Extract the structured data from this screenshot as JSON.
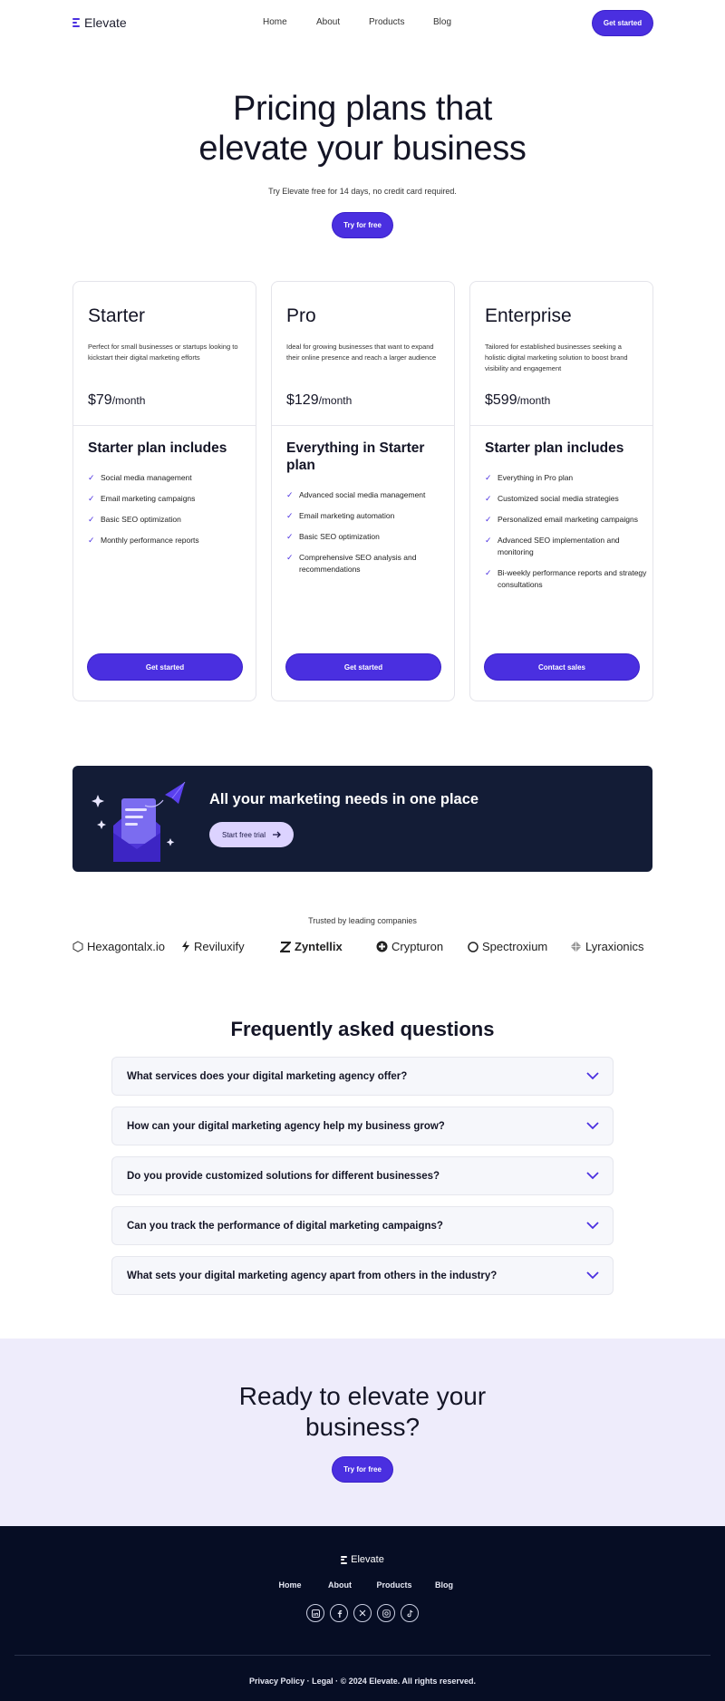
{
  "colors": {
    "accent": "#4a2fe0",
    "banner_bg": "#131c36",
    "cta_bg": "#eeecfb",
    "footer_bg": "#060d24"
  },
  "nav": {
    "brand": "Elevate",
    "links": [
      "Home",
      "About",
      "Products",
      "Blog"
    ],
    "cta": "Get started"
  },
  "hero": {
    "title_line1": "Pricing plans that",
    "title_line2": "elevate your business",
    "subtitle": "Try Elevate free for 14 days, no credit card required.",
    "cta": "Try for free"
  },
  "plans": [
    {
      "name": "Starter",
      "description": "Perfect for small businesses or startups looking to kickstart their digital marketing efforts",
      "price": "$79",
      "period": "/month",
      "includes_title": "Starter plan includes",
      "features": [
        "Social media management",
        "Email marketing campaigns",
        "Basic SEO optimization",
        "Monthly performance reports"
      ],
      "button": "Get started"
    },
    {
      "name": "Pro",
      "description": "Ideal for growing businesses that want to expand their online presence and reach a larger audience",
      "price": "$129",
      "period": "/month",
      "includes_title": "Everything in Starter plan",
      "features": [
        "Advanced social media management",
        "Email marketing automation",
        "Basic SEO optimization",
        "Comprehensive SEO analysis and recommendations"
      ],
      "button": "Get started"
    },
    {
      "name": "Enterprise",
      "description": "Tailored for established businesses seeking a holistic digital marketing solution to boost brand visibility and engagement",
      "price": "$599",
      "period": "/month",
      "includes_title": "Starter plan includes",
      "features": [
        "Everything in Pro plan",
        "Customized social media strategies",
        "Personalized email marketing campaigns",
        "Advanced SEO implementation and monitoring",
        "Bi-weekly performance reports and strategy consultations"
      ],
      "button": "Contact sales"
    }
  ],
  "banner": {
    "title": "All your marketing needs in one place",
    "button": "Start free trial"
  },
  "trusted": {
    "label": "Trusted by leading companies",
    "companies": [
      "Hexagontalx.io",
      "Reviluxify",
      "Zyntellix",
      "Crypturon",
      "Spectroxium",
      "Lyraxionics"
    ]
  },
  "faq": {
    "title": "Frequently asked questions",
    "questions": [
      "What services does your digital marketing agency offer?",
      "How can your digital marketing agency help my business grow?",
      "Do you provide customized solutions for different businesses?",
      "Can you track the performance of digital marketing campaigns?",
      "What sets your digital marketing agency apart from others in the industry?"
    ]
  },
  "cta": {
    "title_line1": "Ready to elevate your",
    "title_line2": "business?",
    "button": "Try for free"
  },
  "footer": {
    "brand": "Elevate",
    "links": [
      "Home",
      "About",
      "Products",
      "Blog"
    ],
    "social_icons": [
      "linkedin-icon",
      "facebook-icon",
      "x-icon",
      "instagram-icon",
      "tiktok-icon"
    ],
    "copyright": "Privacy Policy · Legal · © 2024 Elevate. All rights reserved."
  }
}
